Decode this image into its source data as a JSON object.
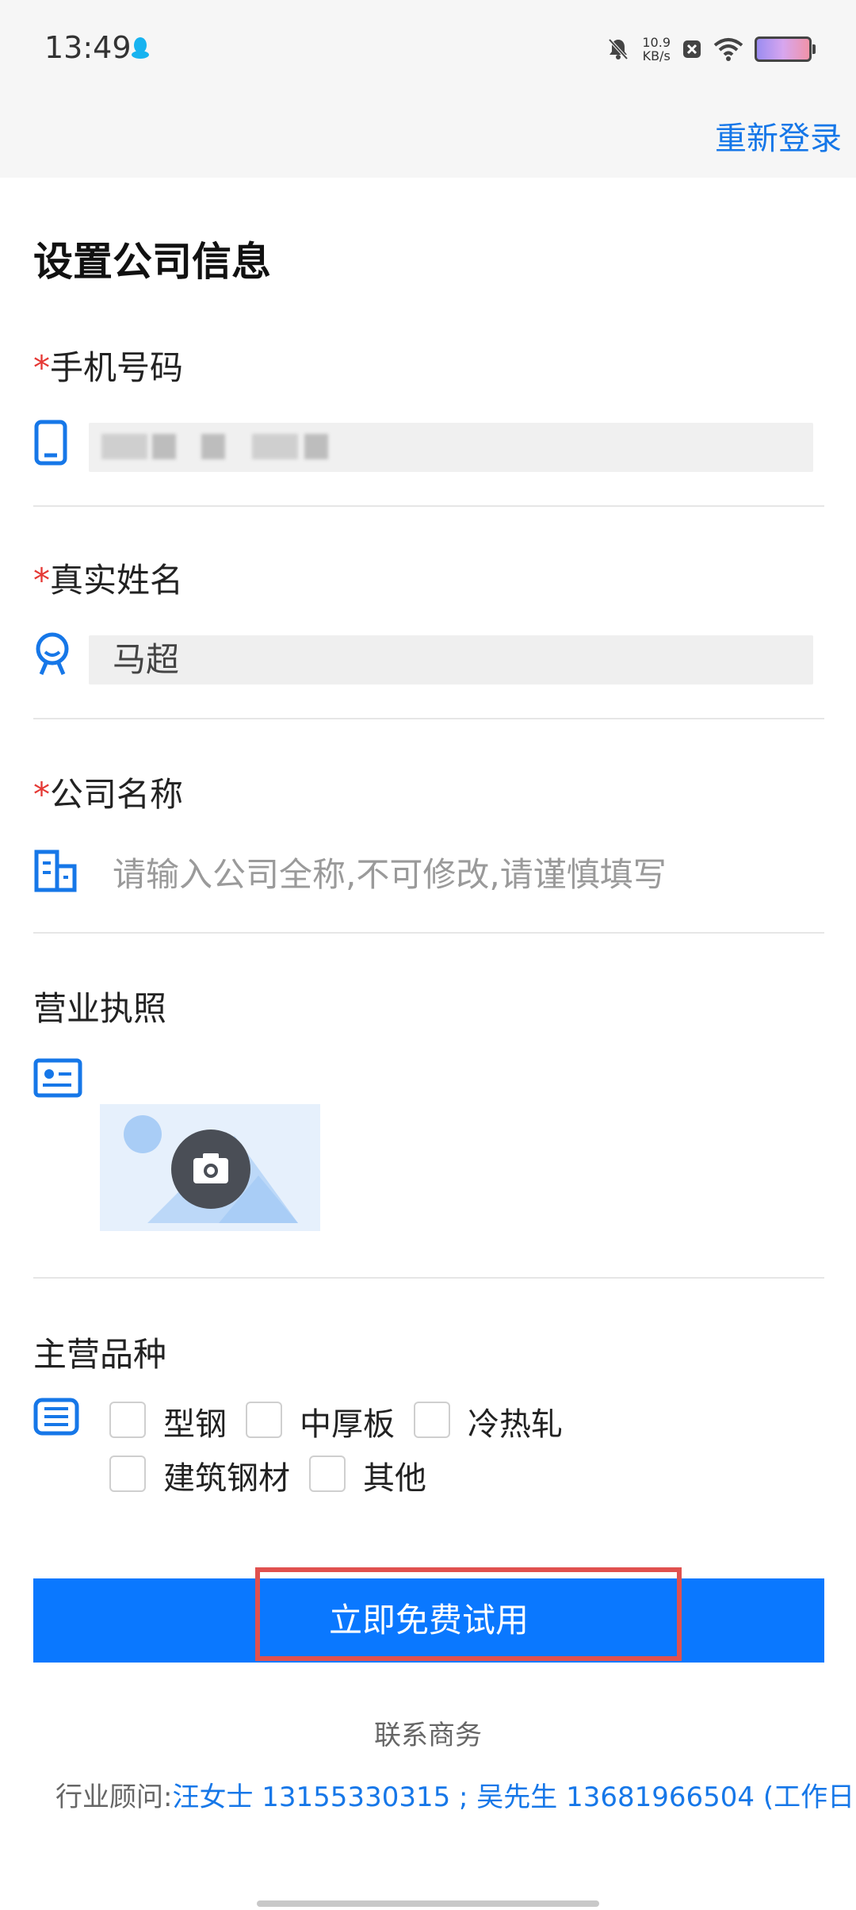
{
  "status_bar": {
    "time": "13:49",
    "speed_value": "10.9",
    "speed_unit": "KB/s"
  },
  "header": {
    "relogin_label": "重新登录"
  },
  "form": {
    "title": "设置公司信息",
    "phone": {
      "required_mark": "*",
      "label": "手机号码"
    },
    "name": {
      "required_mark": "*",
      "label": "真实姓名",
      "value": "马超"
    },
    "company": {
      "required_mark": "*",
      "label": "公司名称",
      "placeholder": "请输入公司全称,不可修改,请谨慎填写"
    },
    "license": {
      "label": "营业执照"
    },
    "varieties": {
      "label": "主营品种",
      "options": [
        "型钢",
        "中厚板",
        "冷热轧",
        "建筑钢材",
        "其他"
      ]
    }
  },
  "cta": {
    "label": "立即免费试用"
  },
  "contact": {
    "title": "联系商务",
    "advisor_prefix": "行业顾问:",
    "advisor_info": "汪女士 13155330315 ; 吴先生 13681966504 (工作日"
  },
  "colors": {
    "accent": "#0a78ff",
    "link": "#1677e8",
    "required": "#e53935",
    "highlight": "#e0514f"
  }
}
